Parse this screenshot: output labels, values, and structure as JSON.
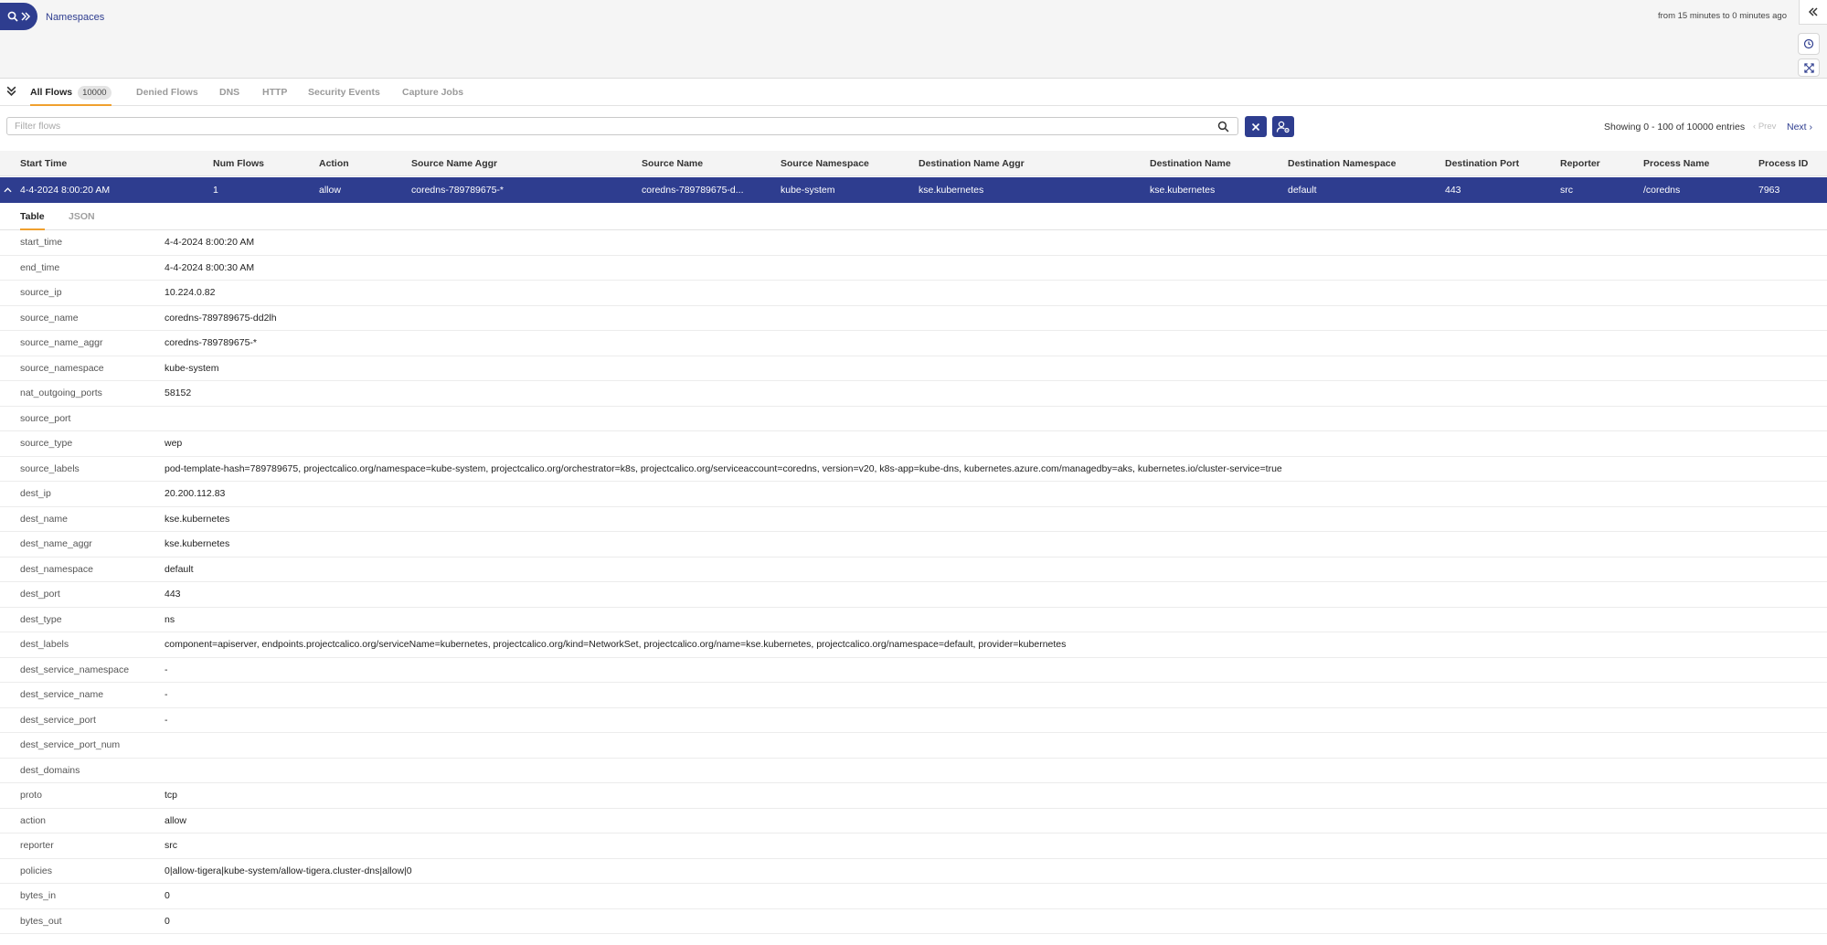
{
  "topbar": {
    "breadcrumb": "Namespaces",
    "time_range": "from 15 minutes to 0 minutes ago",
    "icons": [
      "search-icon",
      "chevrons-right-icon",
      "double-chevron-left-icon",
      "clock-icon",
      "expand-icon"
    ]
  },
  "tabs": [
    {
      "label": "All Flows",
      "count": "10000",
      "active": true
    },
    {
      "label": "Denied Flows"
    },
    {
      "label": "DNS"
    },
    {
      "label": "HTTP"
    },
    {
      "label": "Security Events"
    },
    {
      "label": "Capture Jobs"
    }
  ],
  "filter": {
    "placeholder": "Filter flows",
    "value": "",
    "entries_info": "Showing 0 - 100 of 10000 entries",
    "prev_label": "Prev",
    "next_label": "Next"
  },
  "table": {
    "columns": [
      "Start Time",
      "Num Flows",
      "Action",
      "Source Name Aggr",
      "Source Name",
      "Source Namespace",
      "Destination Name Aggr",
      "Destination Name",
      "Destination Namespace",
      "Destination Port",
      "Reporter",
      "Process Name",
      "Process ID"
    ],
    "selected_row": [
      "4-4-2024 8:00:20 AM",
      "1",
      "allow",
      "coredns-789789675-*",
      "coredns-789789675-d...",
      "kube-system",
      "kse.kubernetes",
      "kse.kubernetes",
      "default",
      "443",
      "src",
      "/coredns",
      "7963"
    ]
  },
  "details": {
    "tabs": [
      "Table",
      "JSON"
    ],
    "active_tab": "Table",
    "rows": [
      {
        "key": "start_time",
        "value": "4-4-2024 8:00:20 AM"
      },
      {
        "key": "end_time",
        "value": "4-4-2024 8:00:30 AM"
      },
      {
        "key": "source_ip",
        "value": "10.224.0.82"
      },
      {
        "key": "source_name",
        "value": "coredns-789789675-dd2lh"
      },
      {
        "key": "source_name_aggr",
        "value": "coredns-789789675-*"
      },
      {
        "key": "source_namespace",
        "value": "kube-system"
      },
      {
        "key": "nat_outgoing_ports",
        "value": "58152"
      },
      {
        "key": "source_port",
        "value": ""
      },
      {
        "key": "source_type",
        "value": "wep"
      },
      {
        "key": "source_labels",
        "value": "pod-template-hash=789789675, projectcalico.org/namespace=kube-system, projectcalico.org/orchestrator=k8s, projectcalico.org/serviceaccount=coredns, version=v20, k8s-app=kube-dns, kubernetes.azure.com/managedby=aks, kubernetes.io/cluster-service=true"
      },
      {
        "key": "dest_ip",
        "value": "20.200.112.83"
      },
      {
        "key": "dest_name",
        "value": "kse.kubernetes"
      },
      {
        "key": "dest_name_aggr",
        "value": "kse.kubernetes"
      },
      {
        "key": "dest_namespace",
        "value": "default"
      },
      {
        "key": "dest_port",
        "value": "443"
      },
      {
        "key": "dest_type",
        "value": "ns"
      },
      {
        "key": "dest_labels",
        "value": "component=apiserver, endpoints.projectcalico.org/serviceName=kubernetes, projectcalico.org/kind=NetworkSet, projectcalico.org/name=kse.kubernetes, projectcalico.org/namespace=default, provider=kubernetes"
      },
      {
        "key": "dest_service_namespace",
        "value": "-"
      },
      {
        "key": "dest_service_name",
        "value": "-"
      },
      {
        "key": "dest_service_port",
        "value": "-"
      },
      {
        "key": "dest_service_port_num",
        "value": ""
      },
      {
        "key": "dest_domains",
        "value": ""
      },
      {
        "key": "proto",
        "value": "tcp"
      },
      {
        "key": "action",
        "value": "allow"
      },
      {
        "key": "reporter",
        "value": "src"
      },
      {
        "key": "policies",
        "value": "0|allow-tigera|kube-system/allow-tigera.cluster-dns|allow|0"
      },
      {
        "key": "bytes_in",
        "value": "0"
      },
      {
        "key": "bytes_out",
        "value": "0"
      }
    ]
  },
  "colors": {
    "primary": "#2e3d8f",
    "accent": "#f0a02e"
  }
}
